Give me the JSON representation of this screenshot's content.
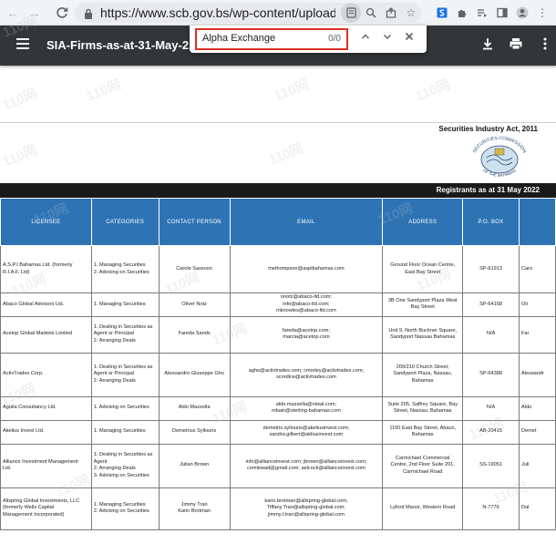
{
  "browser": {
    "url": "https://www.scb.gov.bs/wp-content/uploads/202..."
  },
  "pdf": {
    "title": "SIA-Firms-as-at-31-May-2..."
  },
  "find": {
    "query": "Alpha Exchange",
    "count": "0/0"
  },
  "document": {
    "act_title": "Securities Industry Act, 2011",
    "seal_top": "SECURITIES COMMISSION",
    "seal_bottom": "OF THE BAHAMAS",
    "registrants": "Registrants as at 31 May 2022",
    "watermark": "110网"
  },
  "table": {
    "headers": [
      "LICENSEE",
      "CATEGORIES",
      "CONTACT PERSON",
      "EMAIL",
      "ADDRESS",
      "P.O. BOX",
      ""
    ],
    "rows": [
      {
        "licensee": [
          "A.S.P.I Bahamas Ltd. (formerly",
          "R.I.A.F. Ltd)"
        ],
        "categories": [
          "1. Managing Securities",
          "2. Advising on Securities"
        ],
        "contact": [
          "Carole Sassoon"
        ],
        "email": [
          "methompson@aspibahamas.com"
        ],
        "address": [
          "Ground Floor Ocean Centre,",
          "East Bay Street"
        ],
        "pobox": "SP-61913",
        "extra": "Caro"
      },
      {
        "licensee": [
          "Abaco Global Advisors Ltd."
        ],
        "categories": [
          "1. Managing Securities"
        ],
        "contact": [
          "Oliver Notz"
        ],
        "email": [
          "onotz@abaco-ltd.com;",
          "info@abaco-ltd.com;",
          "mknowles@abaco-ltd.com"
        ],
        "address": [
          "3B One Sandyport Plaza West",
          "Bay Street"
        ],
        "pobox": "SP-64168",
        "extra": "Oli"
      },
      {
        "licensee": [
          "Acetop Global Markets Limited"
        ],
        "categories": [
          "1. Dealing in Securities as",
          "Agent or Principal",
          "2. Arranging Deals"
        ],
        "contact": [
          "Fareda Sands"
        ],
        "email": [
          "fareda@acetop.com;",
          "marcia@acetop.com"
        ],
        "address": [
          "Unit 9, North Buckner Square,",
          "Sandyport Nassau Bahamas"
        ],
        "pobox": "N/A",
        "extra": "Far"
      },
      {
        "licensee": [
          "ActivTrades Corp."
        ],
        "categories": [
          "1. Dealing in Securities as",
          "Agent or Principal",
          "2. Arranging Deals"
        ],
        "contact": [
          "Alessandro Giuseppe Gho"
        ],
        "email": [
          "agho@activtrades.com; cmorley@activtrades.com;",
          "scordice@activtrades.com"
        ],
        "address": [
          "209/210 Church Street,",
          "Sandyport Plaza, Nassau,",
          "Bahamas"
        ],
        "pobox": "SP-64388",
        "extra": "Alessandr"
      },
      {
        "licensee": [
          "Aguila Consultancy Ltd."
        ],
        "categories": [
          "1. Advising on Securities"
        ],
        "contact": [
          "Aldo Mazzella"
        ],
        "email": [
          "aldo.mazzella@niwal.com;",
          "mbain@sterling-bahamas.com"
        ],
        "address": [
          "Suite 205, Saffrey Square, Bay",
          "Street, Nassau, Bahamas"
        ],
        "pobox": "N/A",
        "extra": "Aldo"
      },
      {
        "licensee": [
          "Akelius Invest Ltd."
        ],
        "categories": [
          "1. Managing Securities"
        ],
        "contact": [
          "Demetrius Syllouris"
        ],
        "email": [
          "demetris.syllouris@akeliusinvest.com;",
          "sandra.gilbert@akliusinvest.com"
        ],
        "address": [
          "1100 East Bay Street, Abaco,",
          "Bahamas"
        ],
        "pobox": "AB-20415",
        "extra": "Demet"
      },
      {
        "licensee": [
          "Alliance Investment Management",
          "Ltd."
        ],
        "categories": [
          "1. Dealing in Securities as",
          "Agent",
          "2. Arranging Deals",
          "3. Advising on Securities"
        ],
        "contact": [
          "Julian Brown"
        ],
        "email": [
          "info@allianceinvest.com; jbrown@allianceinvest.com;",
          "comlewad@gmail.com; aelcock@allianceinvest.com"
        ],
        "address": [
          "Carmichael Commercial",
          "Centre, 2nd Floor Suite 201,",
          "Carmichael Road"
        ],
        "pobox": "SS-19051",
        "extra": "Juli"
      },
      {
        "licensee": [
          "Allspring Global Investments, LLC",
          "(formerly Wells Capital",
          "Management Incorporated)"
        ],
        "categories": [
          "1. Managing Securities",
          "2. Advising on Securities"
        ],
        "contact": [
          "Jimmy Tran",
          "Karin Brotman"
        ],
        "email": [
          "karin.brotman@allspring-global.com;",
          "Tiffany.Tran@allspring-global.com;",
          "jimmy.t.tran@allspring-global.com"
        ],
        "address": [
          "Lyford Manor, Western Road"
        ],
        "pobox": "N-7776",
        "extra": "Dal"
      }
    ]
  }
}
